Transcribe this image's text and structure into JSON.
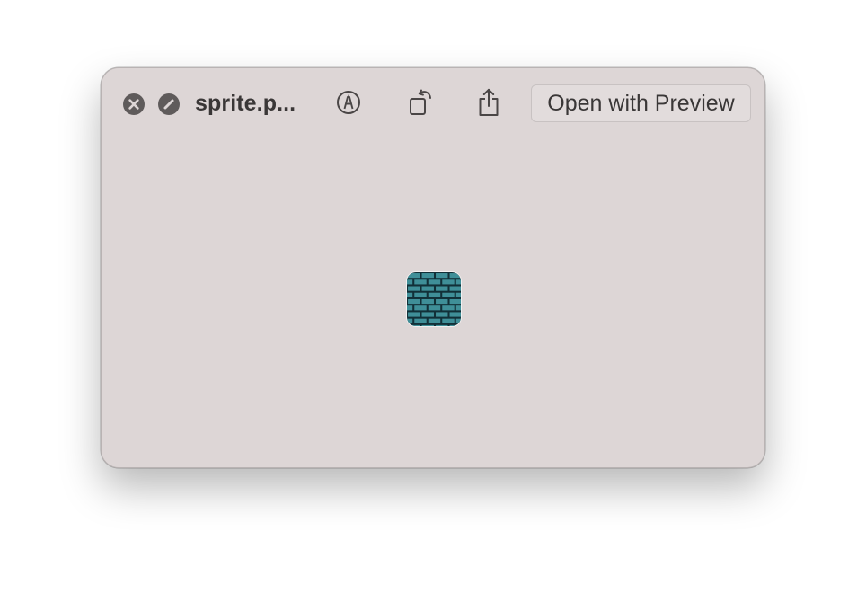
{
  "window": {
    "title": "sprite.p...",
    "open_button_label": "Open with Preview"
  },
  "icons": {
    "close": "close-icon",
    "fullscreen": "fullscreen-icon",
    "markup": "markup-icon",
    "rotate": "rotate-left-icon",
    "share": "share-icon",
    "preview": "brick-sprite-image"
  },
  "colors": {
    "window_background": "#ddd6d6",
    "control_gray": "#5f5b5b",
    "sprite_brick": "#3f8f98",
    "sprite_mortar": "#123038"
  }
}
